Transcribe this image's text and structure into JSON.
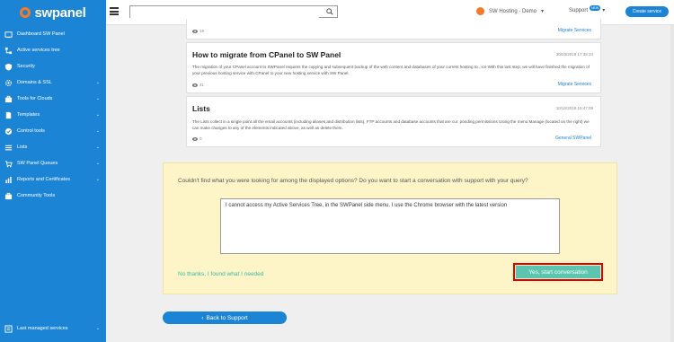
{
  "brand": {
    "name": "swpanel",
    "accent": "#1c84d4",
    "logo_color": "#f47b2a"
  },
  "sidebar": {
    "items": [
      {
        "label": "Dashboard SW Panel",
        "icon": "dashboard-icon",
        "has_chevron": false
      },
      {
        "label": "Active services tree",
        "icon": "tree-icon",
        "has_chevron": false
      },
      {
        "label": "Security",
        "icon": "shield-icon",
        "has_chevron": false
      },
      {
        "label": "Domains & SSL",
        "icon": "gear-icon",
        "has_chevron": true
      },
      {
        "label": "Tools for Clouds",
        "icon": "toolbox-icon",
        "has_chevron": true
      },
      {
        "label": "Templates",
        "icon": "document-icon",
        "has_chevron": true
      },
      {
        "label": "Control tools",
        "icon": "check-circle-icon",
        "has_chevron": true
      },
      {
        "label": "Lists",
        "icon": "list-icon",
        "has_chevron": true
      },
      {
        "label": "SW Panel Queues",
        "icon": "cart-icon",
        "has_chevron": true
      },
      {
        "label": "Reports and Certificates",
        "icon": "chart-icon",
        "has_chevron": true
      },
      {
        "label": "Community Tools",
        "icon": "toolbox-icon",
        "has_chevron": false
      }
    ],
    "bottom_item": {
      "label": "Last managed services",
      "icon": "history-icon",
      "has_chevron": true
    }
  },
  "topbar": {
    "search": {
      "value": "",
      "placeholder": ""
    },
    "account_label": "SW Hosting - Demo",
    "support_label": "Support",
    "support_badge": "NEW",
    "create_label": "Create service"
  },
  "articles": [
    {
      "title": "",
      "date": "",
      "body": "",
      "views": "19",
      "category": "Migrate Services"
    },
    {
      "title": "How to migrate from CPanel to SW Panel",
      "date": "30/03/2019 17:35:24",
      "body": "The migration of your CPanel account to SWPanel requires the copying and subsequent backup of the web content and databases of your current hosting to...ice With this last step, we will have finished the migration of your previous hosting service with CPanel to your new hosting service with SW Panel.",
      "views": "41",
      "category": "Migrate Services"
    },
    {
      "title": "Lists",
      "date": "10/12/2018 15:47:09",
      "body": "The Lists collect in a single point all the email accounts (including aliases and distribution lists), FTP accounts and database accounts that are cur. ponding permissions Using the menu Manage (located on the right) we can make changes to any of the elements indicated above, as well as delete them.",
      "views": "0",
      "category": "General SWPanel"
    }
  ],
  "support_prompt": {
    "question": "Couldn't find what you were looking for among the displayed options? Do you want to start a conversation with support with your query?",
    "message_value": "I cannot access my Active Services Tree, in the SWPanel side menu. I use the Chrome browser with the latest version",
    "no_thanks_label": "No thanks, I found what I needed",
    "start_label": "Yes, start conversation"
  },
  "back_label": "Back to Support"
}
